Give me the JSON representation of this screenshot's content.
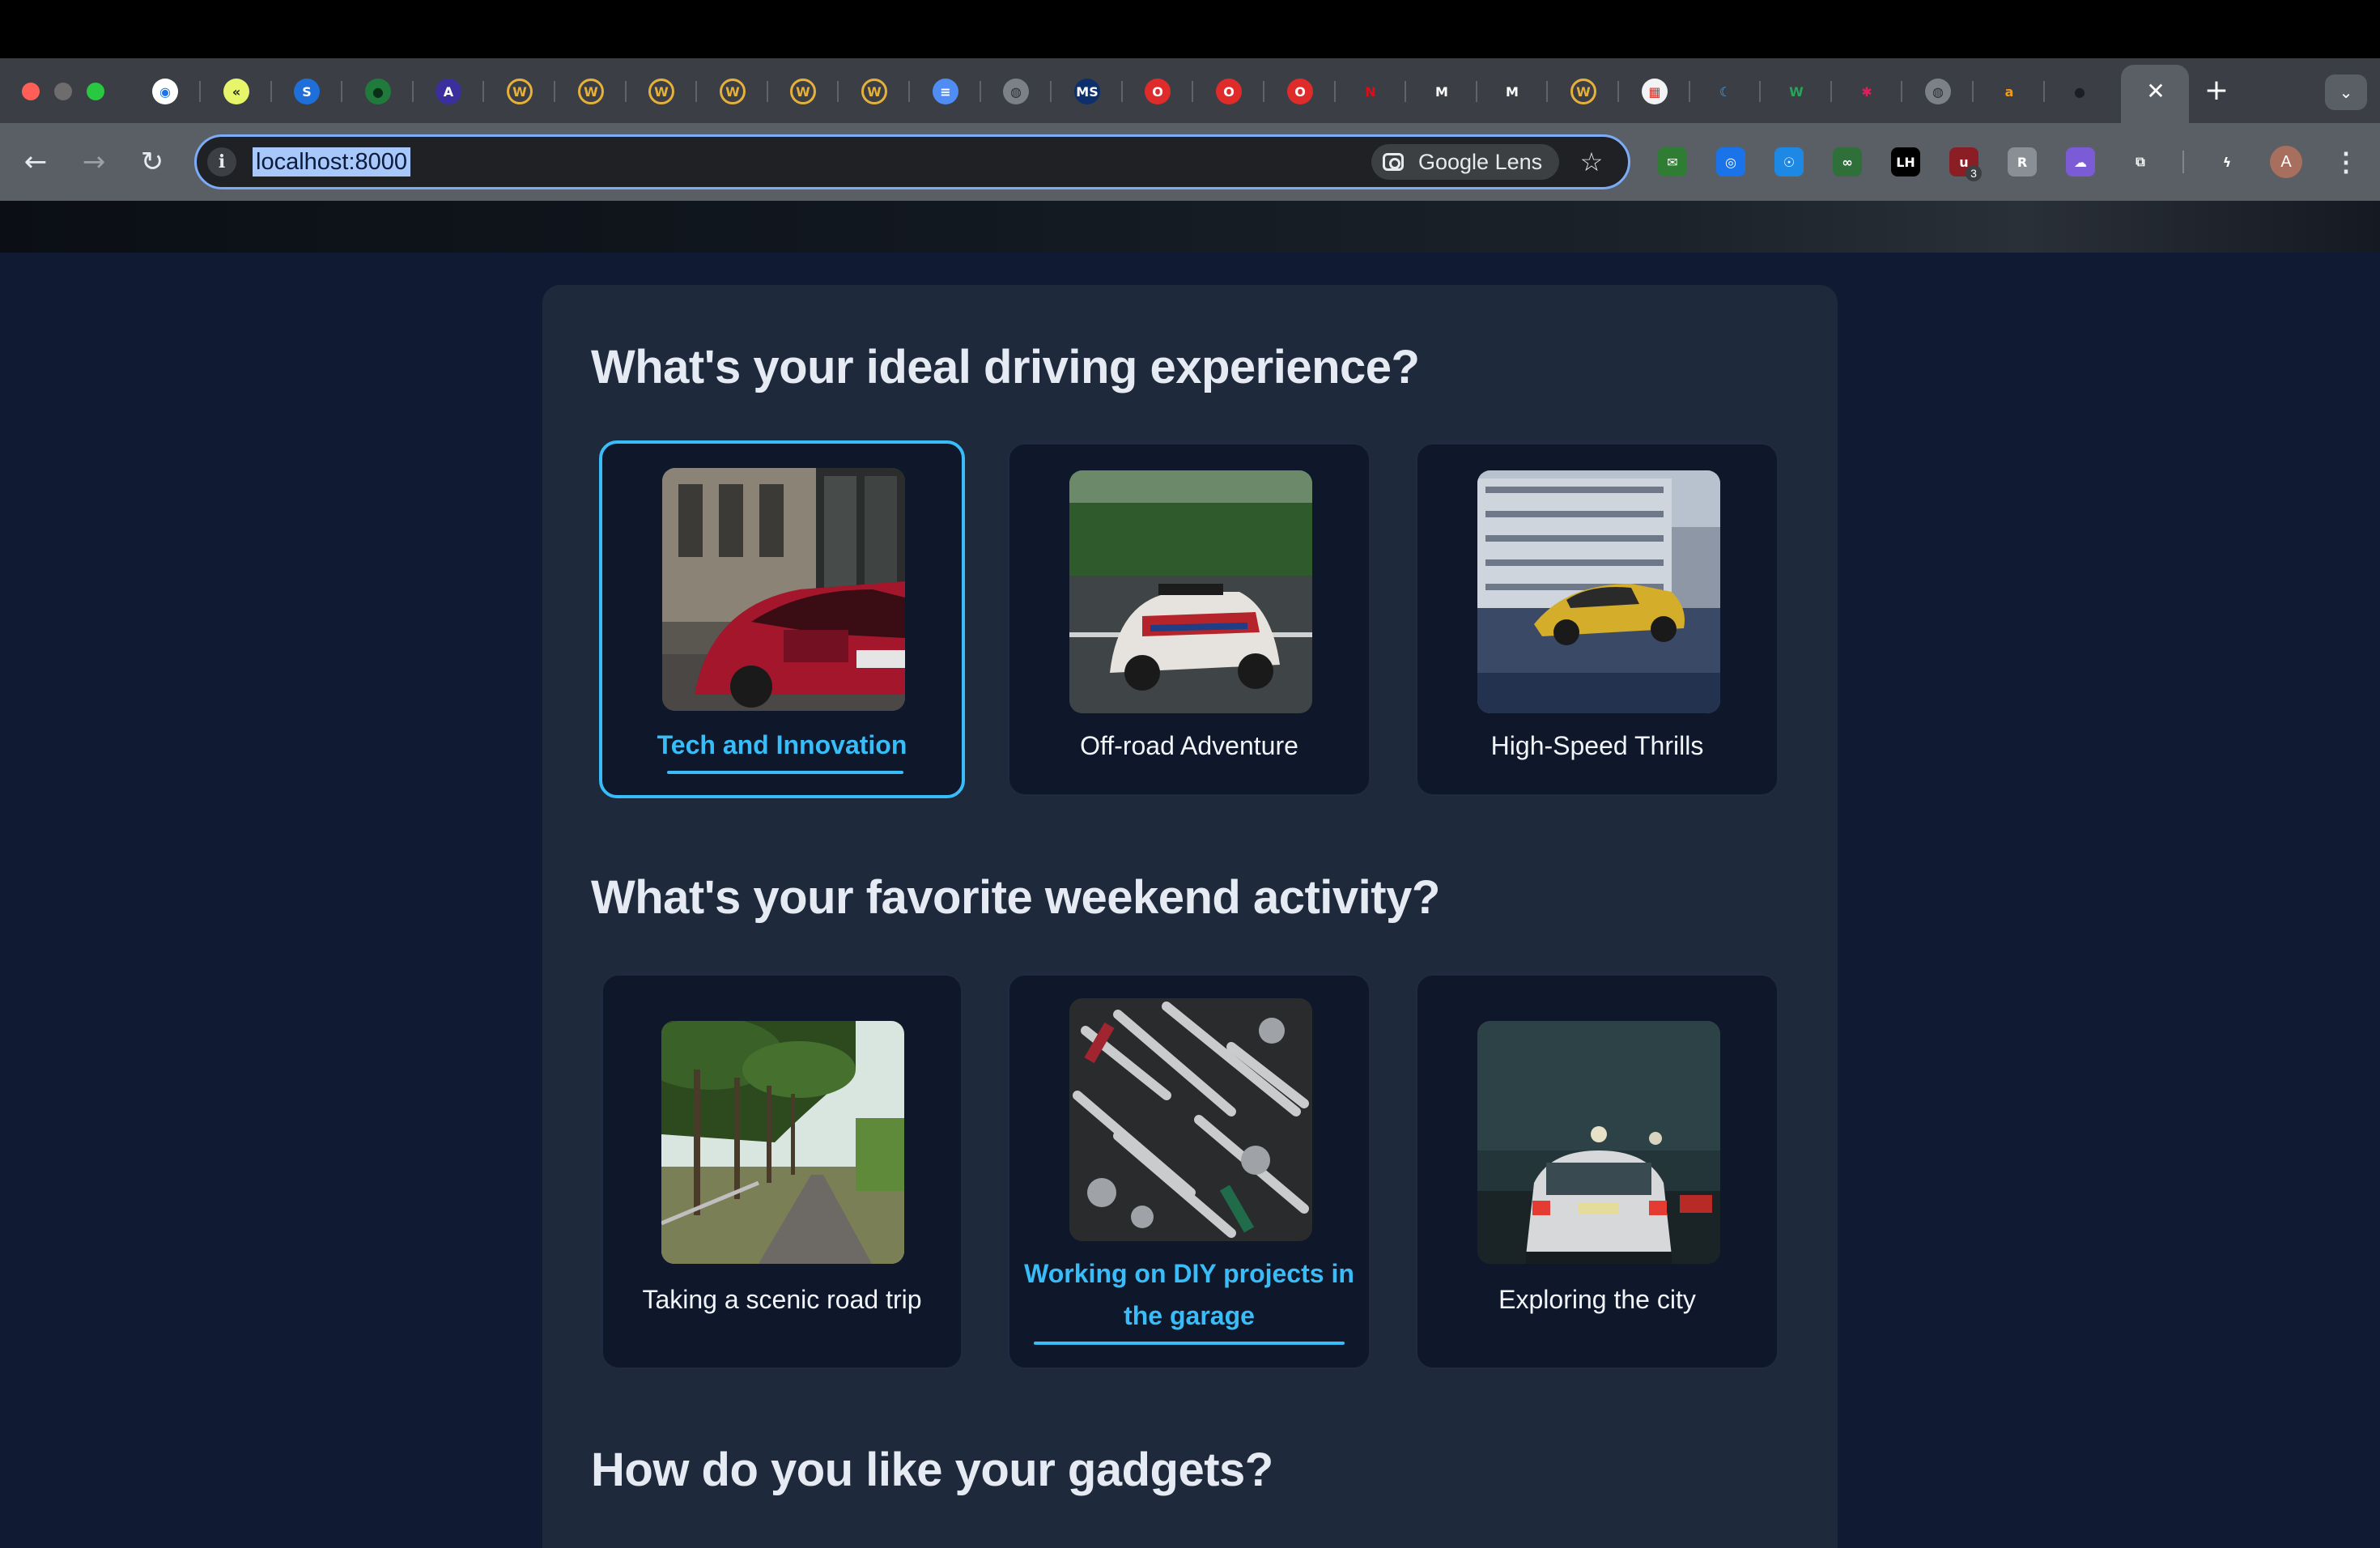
{
  "browser": {
    "url": "localhost:8000",
    "lens_label": "Google Lens",
    "profile_initial": "A",
    "colors": {
      "omnibox_border": "#7cacf8",
      "url_selection": "#a8c7fa",
      "toolbar": "#5a5f66",
      "tabstrip": "#3b3f45"
    },
    "tab_icons": [
      "shield-icon",
      "chevron-logo-icon",
      "s-logo-icon",
      "green-circle-icon",
      "a-logo-icon",
      "w-logo-icon",
      "w-logo-icon",
      "w-logo-icon",
      "w-logo-icon",
      "w-logo-icon",
      "w-logo-icon",
      "doc-icon",
      "globe-icon",
      "morgan-stanley-icon",
      "opera-icon",
      "opera-icon",
      "opera-icon",
      "netflix-icon",
      "m-logo-icon",
      "m-logo-icon",
      "w-logo-icon",
      "calendar-icon",
      "moon-icon",
      "w-green-icon",
      "slack-icon",
      "globe-icon",
      "amazon-icon",
      "github-icon"
    ],
    "extension_icons": [
      "mail-icon",
      "target-icon",
      "owl-icon",
      "glasses-icon",
      "lh-icon",
      "ublock-icon",
      "r-icon",
      "cloud-icon",
      "puzzle-icon",
      "bolt-icon"
    ],
    "extension_badge": "3"
  },
  "quiz": {
    "accent_color": "#38bdf8",
    "questions": [
      {
        "title": "What's your ideal driving experience?",
        "options": [
          {
            "label": "Tech and Innovation",
            "selected": true
          },
          {
            "label": "Off-road Adventure",
            "selected": false
          },
          {
            "label": "High-Speed Thrills",
            "selected": false
          }
        ]
      },
      {
        "title": "What's your favorite weekend activity?",
        "options": [
          {
            "label": "Taking a scenic road trip",
            "selected": false
          },
          {
            "label": "Working on DIY projects in the garage",
            "selected": true
          },
          {
            "label": "Exploring the city",
            "selected": false
          }
        ]
      },
      {
        "title": "How do you like your gadgets?",
        "options": []
      }
    ]
  }
}
